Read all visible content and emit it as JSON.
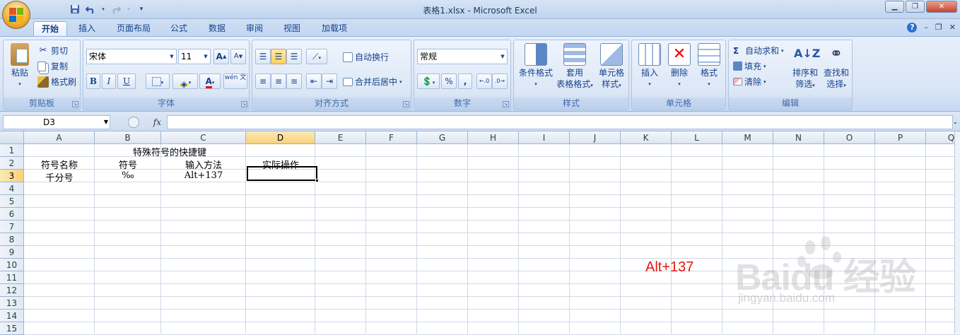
{
  "window": {
    "title": "表格1.xlsx - Microsoft Excel",
    "minimize": "▁",
    "restore": "❐",
    "close": "✕"
  },
  "quick_access": {
    "save_icon": "save-icon",
    "undo_icon": "undo-icon",
    "redo_icon": "redo-icon",
    "customize_icon": "customize-icon"
  },
  "tabs": [
    {
      "label": "开始"
    },
    {
      "label": "插入"
    },
    {
      "label": "页面布局"
    },
    {
      "label": "公式"
    },
    {
      "label": "数据"
    },
    {
      "label": "审阅"
    },
    {
      "label": "视图"
    },
    {
      "label": "加载项"
    }
  ],
  "tab_right": {
    "help": "?",
    "min": "–",
    "restore": "❐",
    "close": "✕"
  },
  "ribbon": {
    "clipboard": {
      "label": "剪贴板",
      "paste": "粘贴",
      "cut": "剪切",
      "copy": "复制",
      "format_painter": "格式刷"
    },
    "font": {
      "label": "字体",
      "font_name": "宋体",
      "font_size": "11",
      "bold": "B",
      "italic": "I",
      "underline": "U",
      "grow": "A",
      "shrink": "A",
      "phonetic": "wén 文"
    },
    "alignment": {
      "label": "对齐方式",
      "wrap_text": "自动换行",
      "merge_center": "合并后居中"
    },
    "number": {
      "label": "数字",
      "format": "常规",
      "percent": "%",
      "comma": ","
    },
    "styles": {
      "label": "样式",
      "conditional": "条件格式",
      "table_format_line1": "套用",
      "table_format_line2": "表格格式",
      "cell_styles_line1": "单元格",
      "cell_styles_line2": "样式"
    },
    "cells": {
      "label": "单元格",
      "insert": "插入",
      "delete": "删除",
      "format": "格式"
    },
    "editing": {
      "label": "编辑",
      "autosum": "自动求和",
      "fill": "填充",
      "clear": "清除",
      "sort_line1": "排序和",
      "sort_line2": "筛选",
      "find_line1": "查找和",
      "find_line2": "选择"
    }
  },
  "formula_bar": {
    "name_box": "D3",
    "fx": "fx",
    "value": ""
  },
  "columns": [
    "A",
    "B",
    "C",
    "D",
    "E",
    "F",
    "G",
    "H",
    "I",
    "J",
    "K",
    "L",
    "M",
    "N",
    "O",
    "P",
    "Q"
  ],
  "rows": [
    "1",
    "2",
    "3",
    "4",
    "5",
    "6",
    "7",
    "8",
    "9",
    "10",
    "11",
    "12",
    "13",
    "14",
    "15"
  ],
  "cells": {
    "B1": "特殊符号的快捷键",
    "A2": "符号名称",
    "B2": "符号",
    "C2": "输入方法",
    "D2": "实际操作",
    "A3": "千分号",
    "B3": "‰",
    "C3": "Alt+137"
  },
  "selection": {
    "active_cell": "D3"
  },
  "overlay_annotation": "Alt+137",
  "watermark": {
    "brand": "Baidu 经验",
    "url": "jingyan.baidu.com"
  },
  "colors": {
    "accent": "#15428b",
    "annotation": "#e0190f",
    "selected_header": "#f8d27a"
  }
}
